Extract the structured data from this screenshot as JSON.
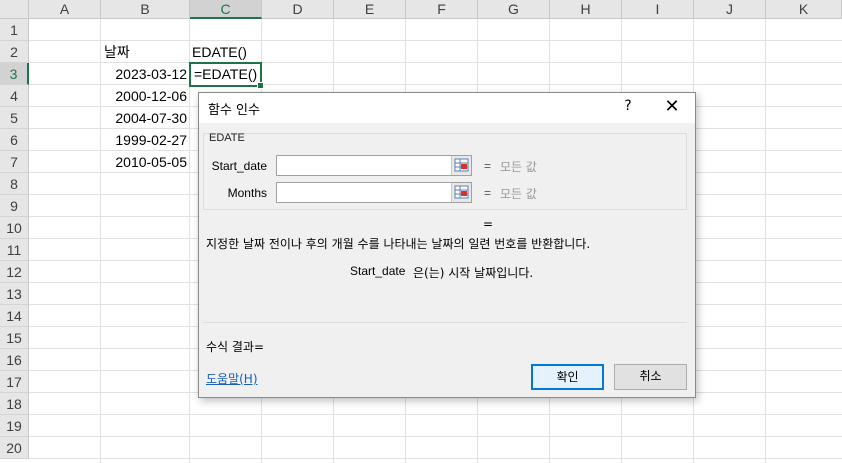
{
  "sheet": {
    "columns": [
      "A",
      "B",
      "C",
      "D",
      "E",
      "F",
      "G",
      "H",
      "I",
      "J",
      "K"
    ],
    "rows": [
      "1",
      "2",
      "3",
      "4",
      "5",
      "6",
      "7",
      "8",
      "9",
      "10",
      "11",
      "12",
      "13",
      "14",
      "15",
      "16",
      "17",
      "18",
      "19",
      "20"
    ],
    "selected_column": "C",
    "selected_row": "3",
    "cells": {
      "B2": "날짜",
      "C2": "EDATE()",
      "B3": "2023-03-12",
      "C3": "=EDATE()",
      "B4": "2000-12-06",
      "B5": "2004-07-30",
      "B6": "1999-02-27",
      "B7": "2010-05-05"
    }
  },
  "dialog": {
    "title": "함수 인수",
    "help_glyph": "?",
    "close_glyph": "✕",
    "function_name": "EDATE",
    "args": [
      {
        "label": "Start_date",
        "value": "",
        "equals": "=",
        "result": "모든 값"
      },
      {
        "label": "Months",
        "value": "",
        "equals": "=",
        "result": "모든 값"
      }
    ],
    "result_equals": "=",
    "description": "지정한 날짜 전이나 후의 개월 수를 나타내는 날짜의 일련 번호를 반환합니다.",
    "arg_desc_name": "Start_date",
    "arg_desc_text": "은(는) 시작 날짜입니다.",
    "formula_result": "수식 결과=",
    "help_link": "도움말(H)",
    "ok_label": "확인",
    "cancel_label": "취소"
  },
  "colors": {
    "excel_green": "#217346",
    "focus_blue": "#0078d7"
  }
}
